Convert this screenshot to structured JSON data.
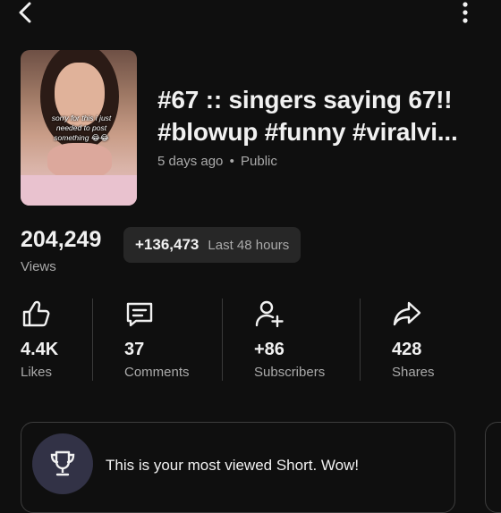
{
  "header": {
    "back_icon": "chevron-left-icon",
    "more_icon": "more-vertical-icon"
  },
  "video": {
    "thumbnail_caption": "sorry for this i just needed to post something 😂😂",
    "title_line1": "#67 :: singers saying 67!!",
    "title_line2": "#blowup #funny #viralvi...",
    "age": "5 days ago",
    "separator": "•",
    "visibility": "Public"
  },
  "views": {
    "count": "204,249",
    "label": "Views",
    "delta": "+136,473",
    "delta_period": "Last 48 hours"
  },
  "stats": [
    {
      "icon": "thumbs-up-icon",
      "value": "4.4K",
      "label": "Likes"
    },
    {
      "icon": "comment-icon",
      "value": "37",
      "label": "Comments"
    },
    {
      "icon": "add-person-icon",
      "value": "+86",
      "label": "Subscribers"
    },
    {
      "icon": "share-icon",
      "value": "428",
      "label": "Shares"
    }
  ],
  "highlight": {
    "icon": "trophy-icon",
    "text": "This is your most viewed Short. Wow!"
  },
  "colors": {
    "background": "#0f0f0f",
    "text": "#f1f1f1",
    "muted": "#aaaaaa",
    "pill": "#272727",
    "trophy_bg": "#323246"
  }
}
